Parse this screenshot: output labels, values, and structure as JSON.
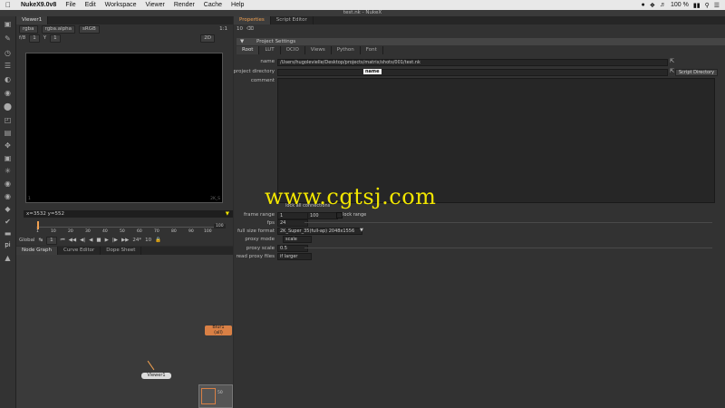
{
  "menubar": {
    "app": "NukeX9.0v8",
    "items": [
      "File",
      "Edit",
      "Workspace",
      "Viewer",
      "Render",
      "Cache",
      "Help"
    ],
    "status": "100 %"
  },
  "window_title": "test.nk - NukeX",
  "viewer": {
    "tab": "Viewer1",
    "channels": "rgba",
    "alpha": "rgba.alpha",
    "lut": "sRGB",
    "frame_a": "f/8",
    "frame_b": "1",
    "y_label": "Y",
    "y_value": "1",
    "zoom": "1:1",
    "mode": "2D",
    "coords": "x=3532 y=552",
    "res_corner": "2K_S",
    "corner_a": "1",
    "timeline_ticks": [
      "1",
      "10",
      "20",
      "30",
      "40",
      "50",
      "60",
      "70",
      "80",
      "90",
      "100"
    ],
    "timeline_end": "100",
    "current_frame": "1",
    "global_label": "Global",
    "fps_field": "24*",
    "increment": "10"
  },
  "lower_tabs": [
    "Node Graph",
    "Curve Editor",
    "Dope Sheet"
  ],
  "nodes": {
    "blur": "Blur1",
    "blur_sub": "(all)",
    "viewer": "Viewer1",
    "mini": "50"
  },
  "properties": {
    "tabs": [
      "Properties",
      "Script Editor"
    ],
    "count": "10",
    "header": "Project Settings",
    "subtabs": [
      "Root",
      "LUT",
      "OCIO",
      "Views",
      "Python",
      "Font"
    ],
    "name_label": "name",
    "name_value": "/Users/hugolevielle/Desktop/projects/matrix/shots/001/test.nk",
    "dir_label": "project directory",
    "dir_tooltip": "name",
    "dir_button": "Script Directory",
    "comment_label": "comment",
    "lock_label": "lock all connections",
    "frame_range_label": "frame range",
    "frame_start": "1",
    "frame_end": "100",
    "lock_range": "lock range",
    "fps_label": "fps",
    "fps_value": "24",
    "format_label": "full size format",
    "format_value": "2K_Super_35(full-ap) 2048x1556",
    "proxy_mode_label": "proxy mode",
    "proxy_mode_value": "scale",
    "proxy_scale_label": "proxy scale",
    "proxy_scale_value": "0.5",
    "read_proxy_label": "read proxy files",
    "read_proxy_value": "if larger"
  },
  "watermark": "www.cgtsj.com",
  "colors": {
    "accent": "#f0a050",
    "node_blur": "#d98045",
    "watermark": "#f2e600"
  }
}
